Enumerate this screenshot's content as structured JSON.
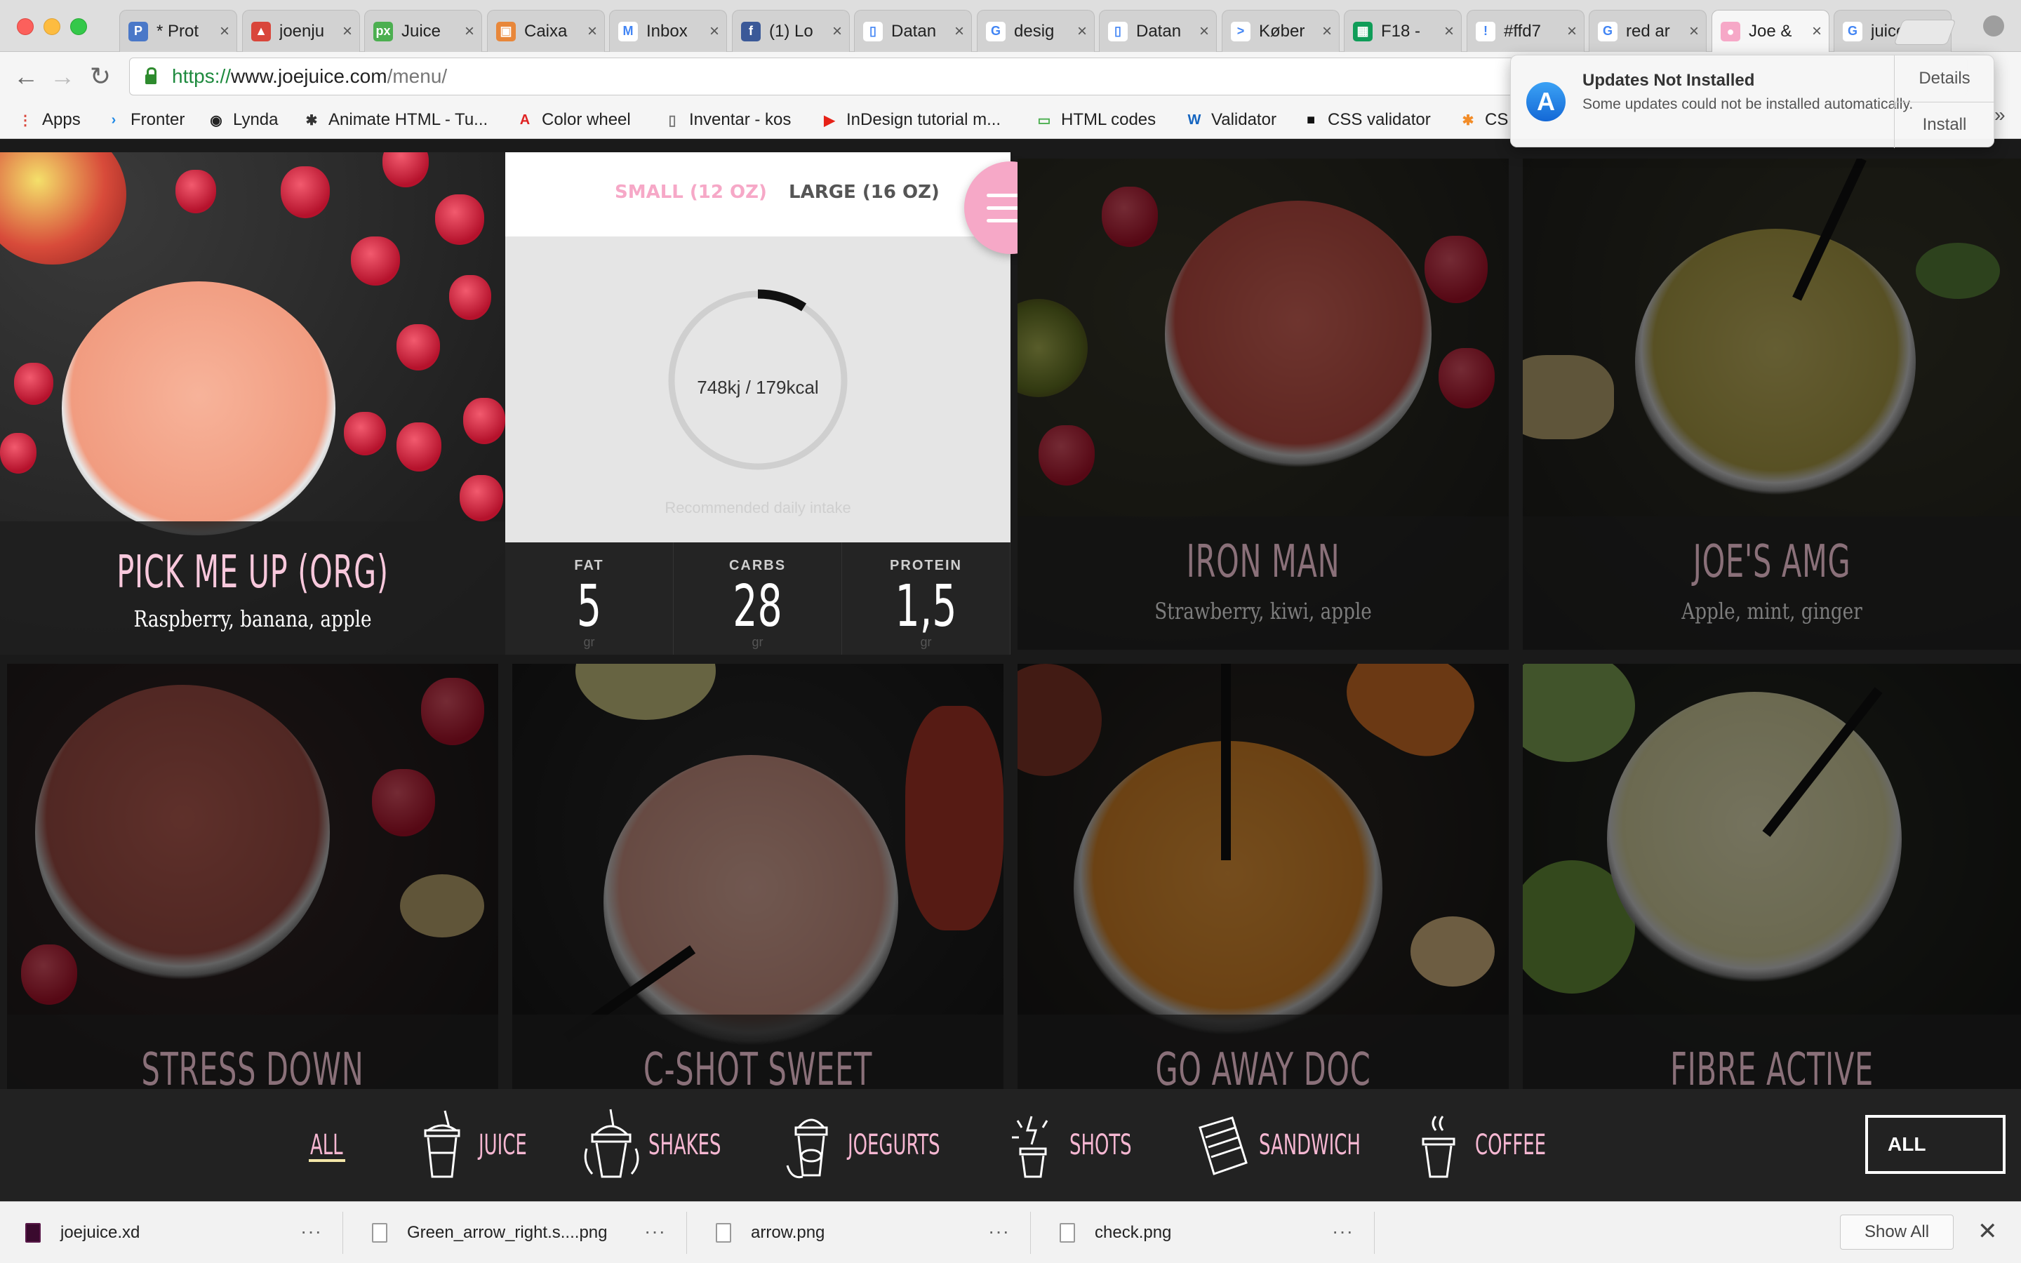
{
  "browser": {
    "tabs": [
      {
        "title": "* Prot",
        "fav_color": "#4a78c8",
        "fav_glyph": "P"
      },
      {
        "title": "joenju",
        "fav_color": "#d9463b",
        "fav_glyph": "▲"
      },
      {
        "title": "Juice",
        "fav_color": "#4caf50",
        "fav_glyph": "px"
      },
      {
        "title": "Caixa",
        "fav_color": "#e8873a",
        "fav_glyph": "▣"
      },
      {
        "title": "Inbox",
        "fav_color": "#ffffff",
        "fav_glyph": "M"
      },
      {
        "title": "(1) Lo",
        "fav_color": "#3b5998",
        "fav_glyph": "f"
      },
      {
        "title": "Datan",
        "fav_color": "#ffffff",
        "fav_glyph": "▯"
      },
      {
        "title": "desig",
        "fav_color": "#ffffff",
        "fav_glyph": "G"
      },
      {
        "title": "Datan",
        "fav_color": "#ffffff",
        "fav_glyph": "▯"
      },
      {
        "title": "Køber",
        "fav_color": "#ffffff",
        "fav_glyph": ">"
      },
      {
        "title": "F18 -",
        "fav_color": "#0f9d58",
        "fav_glyph": "▦"
      },
      {
        "title": "#ffd7",
        "fav_color": "#ffffff",
        "fav_glyph": "!"
      },
      {
        "title": "red ar",
        "fav_color": "#ffffff",
        "fav_glyph": "G"
      },
      {
        "title": "Joe &",
        "fav_color": "#f6a8c7",
        "fav_glyph": "●",
        "active": true
      },
      {
        "title": "juice",
        "fav_color": "#ffffff",
        "fav_glyph": "G"
      }
    ],
    "tab_close": "×",
    "url": {
      "scheme": "https://",
      "host": "www.joejuice.com",
      "path": "/menu/"
    },
    "nav": {
      "back": "←",
      "forward": "→",
      "reload": "↻"
    },
    "bookmarks": [
      {
        "label": "Apps",
        "icon": "apps-grid-icon",
        "glyph": "⋮",
        "color": "#d9463b"
      },
      {
        "label": "Fronter",
        "icon": "fronter-icon",
        "glyph": "›",
        "color": "#1e88e5"
      },
      {
        "label": "Lynda",
        "icon": "lynda-icon",
        "glyph": "◉",
        "color": "#222222"
      },
      {
        "label": "Animate HTML - Tu...",
        "icon": "animate-icon",
        "glyph": "✱",
        "color": "#333333"
      },
      {
        "label": "Color wheel",
        "icon": "adobe-icon",
        "glyph": "A",
        "color": "#e02424"
      },
      {
        "label": "Inventar - kos",
        "icon": "document-icon",
        "glyph": "▯",
        "color": "#777777"
      },
      {
        "label": "InDesign tutorial m...",
        "icon": "youtube-icon",
        "glyph": "▶",
        "color": "#e62117"
      },
      {
        "label": "HTML codes",
        "icon": "html-codes-icon",
        "glyph": "▭",
        "color": "#4caf50"
      },
      {
        "label": "Validator",
        "icon": "w3c-icon",
        "glyph": "W",
        "color": "#1565c0"
      },
      {
        "label": "CSS validator",
        "icon": "css-validator-icon",
        "glyph": "■",
        "color": "#111111"
      },
      {
        "label": "CS",
        "icon": "asterisk-icon",
        "glyph": "✱",
        "color": "#f28c28"
      }
    ],
    "bookmarks_more": "»"
  },
  "notification": {
    "title": "Updates Not Installed",
    "body": "Some updates could not be installed automatically.",
    "details_label": "Details",
    "install_label": "Install",
    "icon": "app-store-icon",
    "icon_glyph": "A"
  },
  "featured": {
    "title": "PICK ME UP (ORG)",
    "subtitle": "Raspberry, banana, apple",
    "sizes": [
      {
        "label": "SMALL (12 OZ)",
        "color": "#f6a8c7",
        "selected": true
      },
      {
        "label": "LARGE (16 OZ)",
        "color": "#555555",
        "selected": false
      }
    ],
    "energy": "748kj / 179kcal",
    "daily_intake_fraction": 0.0895,
    "daily_intake_label": "Recommended daily intake",
    "nutrition": [
      {
        "label": "FAT",
        "value": "5",
        "unit": "gr"
      },
      {
        "label": "CARBS",
        "value": "28",
        "unit": "gr"
      },
      {
        "label": "PROTEIN",
        "value": "1,5",
        "unit": "gr"
      }
    ]
  },
  "products": [
    {
      "title": "IRON MAN",
      "subtitle": "Strawberry, kiwi, apple"
    },
    {
      "title": "JOE'S AMG",
      "subtitle": "Apple, mint, ginger"
    },
    {
      "title": "STRESS DOWN",
      "subtitle": ""
    },
    {
      "title": "C-SHOT SWEET",
      "subtitle": ""
    },
    {
      "title": "GO AWAY DOC",
      "subtitle": ""
    },
    {
      "title": "FIBRE ACTIVE",
      "subtitle": ""
    }
  ],
  "categories": [
    {
      "label": "ALL",
      "icon": "",
      "active": true
    },
    {
      "label": "JUICE",
      "icon": "juice-cup-icon"
    },
    {
      "label": "SHAKES",
      "icon": "shake-icon"
    },
    {
      "label": "JOEGURTS",
      "icon": "joegurt-icon"
    },
    {
      "label": "SHOTS",
      "icon": "shot-icon"
    },
    {
      "label": "SANDWICH",
      "icon": "sandwich-icon"
    },
    {
      "label": "COFFEE",
      "icon": "coffee-icon"
    }
  ],
  "filter_select": {
    "value": "ALL"
  },
  "downloads": [
    {
      "name": "joejuice.xd",
      "icon": "xd-file-icon"
    },
    {
      "name": "Green_arrow_right.s....png",
      "icon": "png-file-icon"
    },
    {
      "name": "arrow.png",
      "icon": "png-file-icon"
    },
    {
      "name": "check.png",
      "icon": "png-file-icon"
    }
  ],
  "downloads_more": "···",
  "show_all_label": "Show All",
  "close_glyph": "✕",
  "colors": {
    "accent_pink": "#f6a8c7",
    "card_title": "#f8c8dc",
    "dim_title": "#8a7079",
    "underline": "#f3e6a8"
  }
}
